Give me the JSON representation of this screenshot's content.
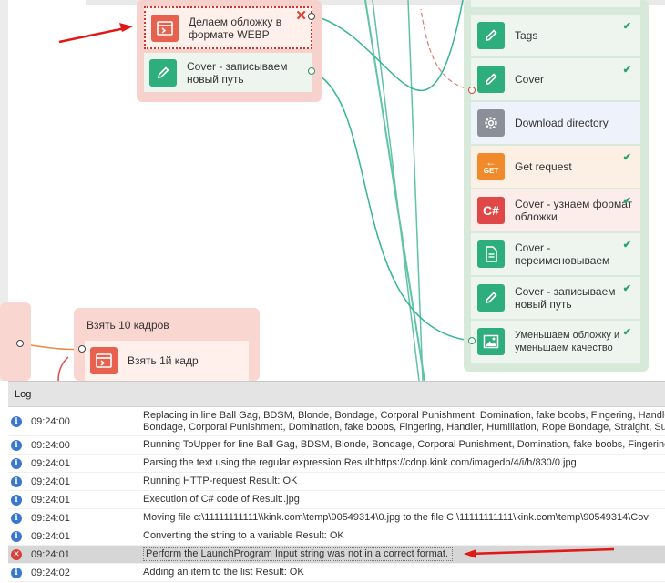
{
  "canvas": {
    "top_group": {
      "items": [
        {
          "label": "Делаем обложку в формате WEBP",
          "icon": "program-icon",
          "color": "#e6624f"
        },
        {
          "label": "Cover - записываем новый путь",
          "icon": "pencil-icon",
          "color": "#2eae7c"
        }
      ]
    },
    "mid_group": {
      "title": "Взять 10 кадров",
      "items": [
        {
          "label": "Взять 1й кадр",
          "icon": "program-icon",
          "color": "#e6624f"
        }
      ]
    },
    "right_group": {
      "items": [
        {
          "label": "Tags",
          "icon": "pencil-icon",
          "color": "#2eae7c"
        },
        {
          "label": "Cover",
          "icon": "pencil-icon",
          "color": "#2eae7c"
        },
        {
          "label": "Download directory",
          "icon": "gear-icon",
          "color": "#8a8f98"
        },
        {
          "label": "Get request",
          "icon": "get-icon",
          "icon_text": "GET",
          "color": "#f08a2b"
        },
        {
          "label": "Cover - узнаем формат обложки",
          "icon": "csharp-icon",
          "icon_text": "C#",
          "color": "#e04848"
        },
        {
          "label": "Cover - переименовываем",
          "icon": "file-icon",
          "color": "#2eae7c"
        },
        {
          "label": "Cover - записываем новый путь",
          "icon": "pencil-icon",
          "color": "#2eae7c"
        },
        {
          "label": "Уменьшаем обложку и уменьшаем качество",
          "icon": "image-icon",
          "color": "#2eae7c"
        }
      ]
    }
  },
  "log": {
    "title": "Log",
    "rows": [
      {
        "type": "info",
        "time": "09:24:00",
        "message": "Replacing in line Ball Gag, BDSM, Blonde, Bondage, Corporal Punishment, Domination, fake boobs, Fingering, Handler, H",
        "message2": "Bondage, Corporal Punishment, Domination, fake boobs, Fingering, Handler, Humiliation, Rope Bondage, Straight, Subm"
      },
      {
        "type": "info",
        "time": "09:24:00",
        "message": "Running ToUpper for line Ball Gag, BDSM, Blonde, Bondage, Corporal Punishment, Domination, fake boobs, Fingering, H"
      },
      {
        "type": "info",
        "time": "09:24:01",
        "message": "Parsing the text using the regular expression  Result:https://cdnp.kink.com/imagedb/4/i/h/830/0.jpg"
      },
      {
        "type": "info",
        "time": "09:24:01",
        "message": "Running HTTP-request  Result: OK"
      },
      {
        "type": "info",
        "time": "09:24:01",
        "message": "Execution of C# code of  Result:.jpg"
      },
      {
        "type": "info",
        "time": "09:24:01",
        "message": "Moving file c:\\11111111111\\\\kink.com\\temp\\90549314\\0.jpg to the file C:\\11111111111\\kink.com\\temp\\90549314\\Cov"
      },
      {
        "type": "info",
        "time": "09:24:01",
        "message": "Converting the string to a variable  Result: OK"
      },
      {
        "type": "error",
        "time": "09:24:01",
        "message": "Perform the LaunchProgram  Input string was not in a correct format."
      },
      {
        "type": "info",
        "time": "09:24:02",
        "message": "Adding an item to the list   Result: OK"
      }
    ]
  }
}
